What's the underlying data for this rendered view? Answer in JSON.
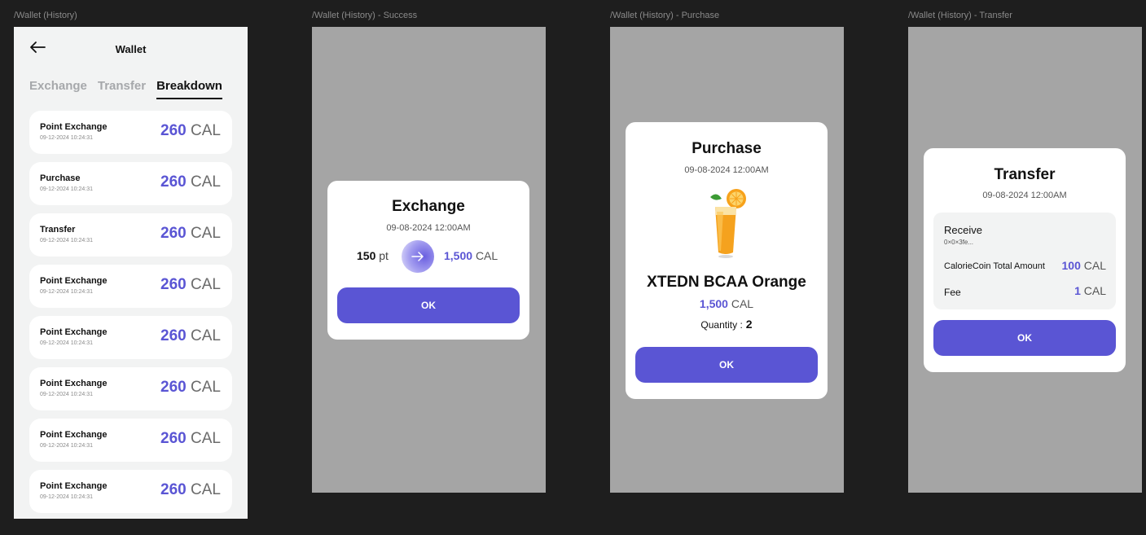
{
  "frames": {
    "history": "/Wallet (History)",
    "success": "/Wallet (History) - Success",
    "purchase": "/Wallet (History) - Purchase",
    "transfer": "/Wallet (History) - Transfer"
  },
  "wallet": {
    "title": "Wallet",
    "tabs": [
      {
        "label": "Exchange",
        "active": false
      },
      {
        "label": "Transfer",
        "active": false
      },
      {
        "label": "Breakdown",
        "active": true
      }
    ],
    "items": [
      {
        "title": "Point Exchange",
        "date": "09-12-2024 10:24:31",
        "amount": "260",
        "unit": "CAL"
      },
      {
        "title": "Purchase",
        "date": "09-12-2024 10:24:31",
        "amount": "260",
        "unit": "CAL"
      },
      {
        "title": "Transfer",
        "date": "09-12-2024 10:24:31",
        "amount": "260",
        "unit": "CAL"
      },
      {
        "title": "Point Exchange",
        "date": "09-12-2024 10:24:31",
        "amount": "260",
        "unit": "CAL"
      },
      {
        "title": "Point Exchange",
        "date": "09-12-2024 10:24:31",
        "amount": "260",
        "unit": "CAL"
      },
      {
        "title": "Point Exchange",
        "date": "09-12-2024 10:24:31",
        "amount": "260",
        "unit": "CAL"
      },
      {
        "title": "Point Exchange",
        "date": "09-12-2024 10:24:31",
        "amount": "260",
        "unit": "CAL"
      },
      {
        "title": "Point Exchange",
        "date": "09-12-2024 10:24:31",
        "amount": "260",
        "unit": "CAL"
      }
    ]
  },
  "exchange": {
    "title": "Exchange",
    "date": "09-08-2024 12:00AM",
    "from_value": "150",
    "from_unit": "pt",
    "to_value": "1,500",
    "to_unit": "CAL",
    "ok": "OK"
  },
  "purchase": {
    "title": "Purchase",
    "date": "09-08-2024 12:00AM",
    "product": "XTEDN BCAA Orange",
    "price": "1,500",
    "unit": "CAL",
    "qty_label": "Quantity :",
    "qty": "2",
    "ok": "OK"
  },
  "transfer": {
    "title": "Transfer",
    "date": "09-08-2024 12:00AM",
    "receive_label": "Receive",
    "address": "0×0×3fe...",
    "total_label": "CalorieCoin Total Amount",
    "total_value": "100",
    "total_unit": "CAL",
    "fee_label": "Fee",
    "fee_value": "1",
    "fee_unit": "CAL",
    "ok": "OK"
  },
  "colors": {
    "accent": "#5a55d4",
    "background": "#1e1e1e",
    "overlay": "#a5a5a5"
  }
}
